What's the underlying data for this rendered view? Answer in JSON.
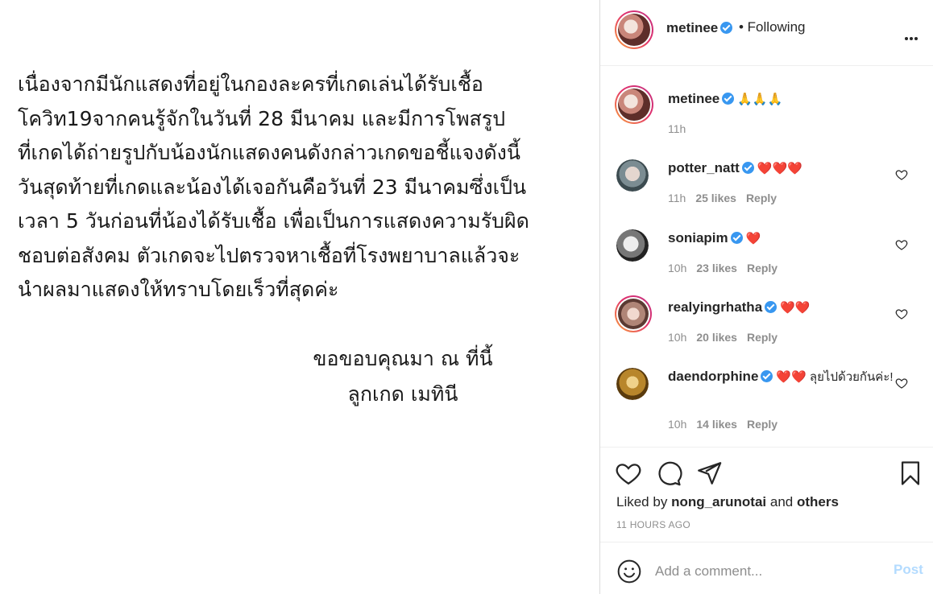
{
  "post_image": {
    "body": "เนื่องจากมีนักแสดงที่อยู่ในกองละครที่เกดเล่นได้รับเชื้อ\nโควิท19จากคนรู้จักในวันที่ 28 มีนาคม และมีการโพสรูป\nที่เกดได้ถ่ายรูปกับน้องนักแสดงคนดังกล่าวเกดขอชี้แจงดังนี้\nวันสุดท้ายที่เกดและน้องได้เจอกันคือวันที่ 23 มีนาคมซึ่งเป็น\nเวลา 5 วันก่อนที่น้องได้รับเชื้อ เพื่อเป็นการแสดงความรับผิด\nชอบต่อสังคม ตัวเกดจะไปตรวจหาเชื้อที่โรงพยาบาลแล้วจะ\nนำผลมาแสดงให้ทราบโดยเร็วที่สุดค่ะ",
    "signoff": "ขอขอบคุณมา ณ ที่นี้\nลูกเกด เมทินี"
  },
  "header": {
    "username": "metinee",
    "following_label": "• Following"
  },
  "comments": [
    {
      "username": "metinee",
      "text": "🙏🙏🙏",
      "time": "11h",
      "likes": "",
      "reply": ""
    },
    {
      "username": "potter_natt",
      "text": "❤️❤️❤️",
      "time": "11h",
      "likes": "25 likes",
      "reply": "Reply"
    },
    {
      "username": "soniapim",
      "text": "❤️",
      "time": "10h",
      "likes": "23 likes",
      "reply": "Reply"
    },
    {
      "username": "realyingrhatha",
      "text": "❤️❤️",
      "time": "10h",
      "likes": "20 likes",
      "reply": "Reply"
    },
    {
      "username": "daendorphine",
      "text": "❤️❤️ ลุยไปด้วยกันค่ะ!",
      "time": "10h",
      "likes": "14 likes",
      "reply": "Reply"
    }
  ],
  "actions": {
    "liked_by_prefix": "Liked by",
    "liked_by_user": "nong_arunotai",
    "liked_by_and": "and",
    "liked_by_others": "others",
    "time_ago": "11 HOURS AGO"
  },
  "add_comment": {
    "placeholder": "Add a comment...",
    "post_label": "Post"
  },
  "colors": {
    "verified": "#3897f0",
    "muted": "#8e8e8e",
    "post_disabled": "#b3dbff"
  }
}
